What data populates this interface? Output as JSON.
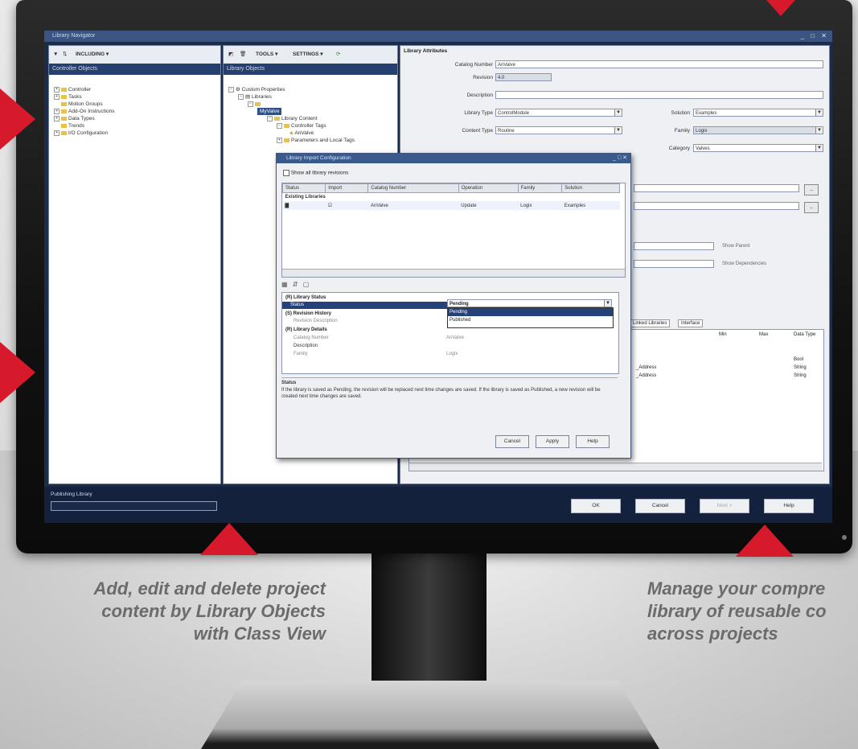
{
  "app": {
    "title": "Library Navigator",
    "window_controls": "_ □ ✕"
  },
  "left_pane": {
    "toolbar_label": "INCLUDING ▾",
    "header": "Controller Objects",
    "items": [
      "Controller",
      "Tasks",
      "Motion Groups",
      "Add-On Instructions",
      "Data Types",
      "Trends",
      "I/O Configuration"
    ],
    "footer_label": "Publishing Library"
  },
  "middle_pane": {
    "toolbar": {
      "tools": "TOOLS ▾",
      "settings": "SETTINGS ▾"
    },
    "header": "Library Objects",
    "items": [
      "Custom Properties",
      "Libraries",
      "",
      "MyValve",
      "Library Content",
      "Controller Tags",
      "AnValve",
      "Parameters and Local Tags"
    ]
  },
  "right_pane": {
    "header": "Library Attributes",
    "fields": {
      "catalog_number": {
        "label": "Catalog Number",
        "value": "AnValve"
      },
      "revision": {
        "label": "Revision",
        "value": "4.0"
      },
      "description": {
        "label": "Description",
        "value": ""
      },
      "library_type": {
        "label": "Library Type",
        "value": "ControlModule"
      },
      "content_type": {
        "label": "Content Type",
        "value": "Routine"
      },
      "solution": {
        "label": "Solution",
        "value": "Examples"
      },
      "family": {
        "label": "Family",
        "value": "Logix"
      },
      "category": {
        "label": "Category",
        "value": "Valves"
      }
    },
    "link_labels": {
      "show_parent": "Show Parent",
      "show_dependencies": "Show Dependencies"
    },
    "browse_label": "...",
    "tabs": [
      "Linked Libraries",
      "Interface"
    ],
    "table_headers": [
      "Min",
      "Max",
      "Data Type"
    ],
    "table_rows": [
      {
        "name": "",
        "data_type": "Bool"
      },
      {
        "name": "_Address",
        "data_type": "String"
      },
      {
        "name": "_Address",
        "data_type": "String"
      }
    ]
  },
  "dialog": {
    "title": "Library Import Configuration",
    "checkbox_label": "Show all library revisions",
    "columns": [
      "Status",
      "Import",
      "Catalog Number",
      "Operation",
      "Family",
      "Solution"
    ],
    "group_label": "Existing Libraries",
    "row": {
      "catalog_number": "AnValve",
      "operation": "Update",
      "family": "Logix",
      "solution": "Examples"
    },
    "properties": {
      "cat_status": "(R) Library Status",
      "status_label": "Status",
      "cat_revision": "(S) Revision History",
      "revision_desc": "Revision Description",
      "cat_details": "(R) Library Details",
      "catalog_number_label": "Catalog Number",
      "catalog_number_value": "AnValve",
      "description_label": "Description",
      "family_label": "Family",
      "family_value": "Logix"
    },
    "status_dropdown": {
      "selected": "Pending",
      "options": [
        "Pending",
        "Published"
      ]
    },
    "help_title": "Status",
    "help_text": "If the library is saved as Pending, the revision will be replaced next time changes are saved. If the library is saved as Published, a new revision will be created next time changes are saved.",
    "buttons": {
      "cancel": "Cancel",
      "apply": "Apply",
      "help": "Help"
    }
  },
  "bottom_buttons": {
    "ok": "OK",
    "cancel": "Cancel",
    "next": "Next >",
    "help": "Help"
  },
  "captions": {
    "left": [
      "Add, edit and delete project",
      "content by Library Objects",
      "with Class View"
    ],
    "right": [
      "Manage your compre",
      "library of reusable co",
      "across projects"
    ]
  },
  "colors": {
    "accent_red": "#d6192b",
    "screen_navy": "#1c2c49",
    "caption_gray": "#6b6b6b"
  }
}
